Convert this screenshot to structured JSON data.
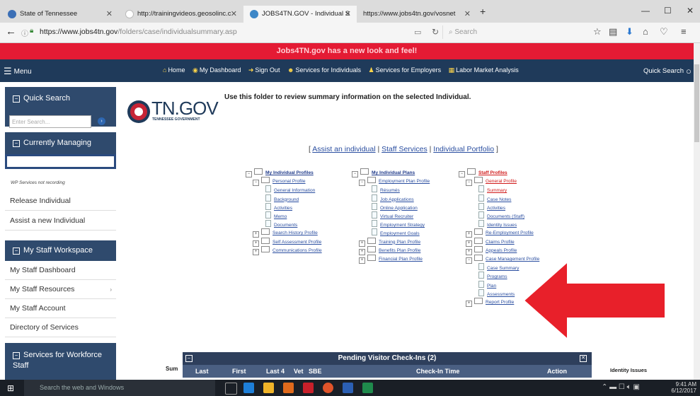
{
  "browser": {
    "tabs": [
      {
        "title": "State of Tennessee",
        "active": false
      },
      {
        "title": "http://trainingvideos.geosolinc.c",
        "active": false
      },
      {
        "title": "JOBS4TN.GOV - Individual S",
        "active": true
      },
      {
        "title": "https://www.jobs4tn.gov/vosnet",
        "active": false
      }
    ],
    "new_tab": "+",
    "url_domain": "https://www.jobs4tn.gov",
    "url_path": "/folders/case/individualsummary.asp",
    "search_placeholder": "Search"
  },
  "banner": "Jobs4TN.gov has a new look and feel!",
  "sitenav": {
    "menu_label": "Menu",
    "links": [
      "Home",
      "My Dashboard",
      "Sign Out",
      "Services for Individuals",
      "Services for Employers",
      "Labor Market Analysis"
    ],
    "quick_search": "Quick Search"
  },
  "sidebar": {
    "quick_search_title": "Quick Search",
    "quick_search_placeholder": "Enter Search...",
    "currently_managing_title": "Currently Managing",
    "wp_status": "WP Services not recording",
    "release_individual": "Release Individual",
    "assist_new": "Assist a new Individual",
    "staff_workspace_title": "My Staff Workspace",
    "staff_items": [
      "My Staff Dashboard",
      "My Staff Resources",
      "My Staff Account",
      "Directory of Services"
    ],
    "workforce_title": "Services for Workforce Staff"
  },
  "logo": {
    "text": "TN.GOV",
    "sub": "TENNESSEE GOVERNMENT"
  },
  "intro": "Use this folder to review summary information on the selected Individual.",
  "top_links": [
    "Assist an individual",
    "Staff Services",
    "Individual Portfolio"
  ],
  "tree": {
    "col1": {
      "header": "My Individual Profiles",
      "items": [
        {
          "label": "Personal Profile",
          "level": 1,
          "type": "folder",
          "exp": "-"
        },
        {
          "label": "General Information",
          "level": 2,
          "type": "page"
        },
        {
          "label": "Background",
          "level": 2,
          "type": "page"
        },
        {
          "label": "Activities",
          "level": 2,
          "type": "page"
        },
        {
          "label": "Memo",
          "level": 2,
          "type": "page"
        },
        {
          "label": "Documents",
          "level": 2,
          "type": "page"
        },
        {
          "label": "Search History Profile",
          "level": 1,
          "type": "folder",
          "exp": "+"
        },
        {
          "label": "Self Assessment Profile",
          "level": 1,
          "type": "folder",
          "exp": "+"
        },
        {
          "label": "Communications Profile",
          "level": 1,
          "type": "folder",
          "exp": "+"
        }
      ]
    },
    "col2": {
      "header": "My Individual Plans",
      "items": [
        {
          "label": "Employment Plan Profile",
          "level": 1,
          "type": "folder",
          "exp": "-"
        },
        {
          "label": "Résumés",
          "level": 2,
          "type": "page"
        },
        {
          "label": "Job Applications",
          "level": 2,
          "type": "page"
        },
        {
          "label": "Online Application",
          "level": 2,
          "type": "page"
        },
        {
          "label": "Virtual Recruiter",
          "level": 2,
          "type": "page"
        },
        {
          "label": "Employment Strategy",
          "level": 2,
          "type": "page"
        },
        {
          "label": "Employment Goals",
          "level": 2,
          "type": "page"
        },
        {
          "label": "Training Plan Profile",
          "level": 1,
          "type": "folder",
          "exp": "+"
        },
        {
          "label": "Benefits Plan Profile",
          "level": 1,
          "type": "folder",
          "exp": "+"
        },
        {
          "label": "Financial Plan Profile",
          "level": 1,
          "type": "folder",
          "exp": "+"
        }
      ]
    },
    "col3": {
      "header": "Staff Profiles",
      "items": [
        {
          "label": "General Profile",
          "level": 1,
          "type": "folder",
          "exp": "-",
          "red": true
        },
        {
          "label": "Summary",
          "level": 2,
          "type": "page",
          "red": true
        },
        {
          "label": "Case Notes",
          "level": 2,
          "type": "page"
        },
        {
          "label": "Activities",
          "level": 2,
          "type": "page"
        },
        {
          "label": "Documents (Staff)",
          "level": 2,
          "type": "page"
        },
        {
          "label": "Identity Issues",
          "level": 2,
          "type": "page"
        },
        {
          "label": "Re-Employment Profile",
          "level": 1,
          "type": "folder",
          "exp": "+"
        },
        {
          "label": "Claims Profile",
          "level": 1,
          "type": "folder",
          "exp": "+"
        },
        {
          "label": "Appeals Profile",
          "level": 1,
          "type": "folder",
          "exp": "+"
        },
        {
          "label": "Case Management Profile",
          "level": 1,
          "type": "folder",
          "exp": "-"
        },
        {
          "label": "Case Summary",
          "level": 2,
          "type": "page"
        },
        {
          "label": "Programs",
          "level": 2,
          "type": "page"
        },
        {
          "label": "Plan",
          "level": 2,
          "type": "page"
        },
        {
          "label": "Assessments",
          "level": 2,
          "type": "page"
        },
        {
          "label": "Report Profile",
          "level": 1,
          "type": "folder",
          "exp": "+"
        }
      ]
    }
  },
  "pending": {
    "title": "Pending Visitor Check-Ins (2)",
    "sum_label": "Sum",
    "columns": [
      "Last",
      "First",
      "Last 4",
      "Vet",
      "SBE",
      "Check-In Time",
      "Action"
    ],
    "identity_issues": "Identity Issues"
  },
  "arrow_color": "#e8202a",
  "taskbar": {
    "search": "Search the web and Windows",
    "time": "9:41 AM",
    "date": "6/12/2017"
  }
}
